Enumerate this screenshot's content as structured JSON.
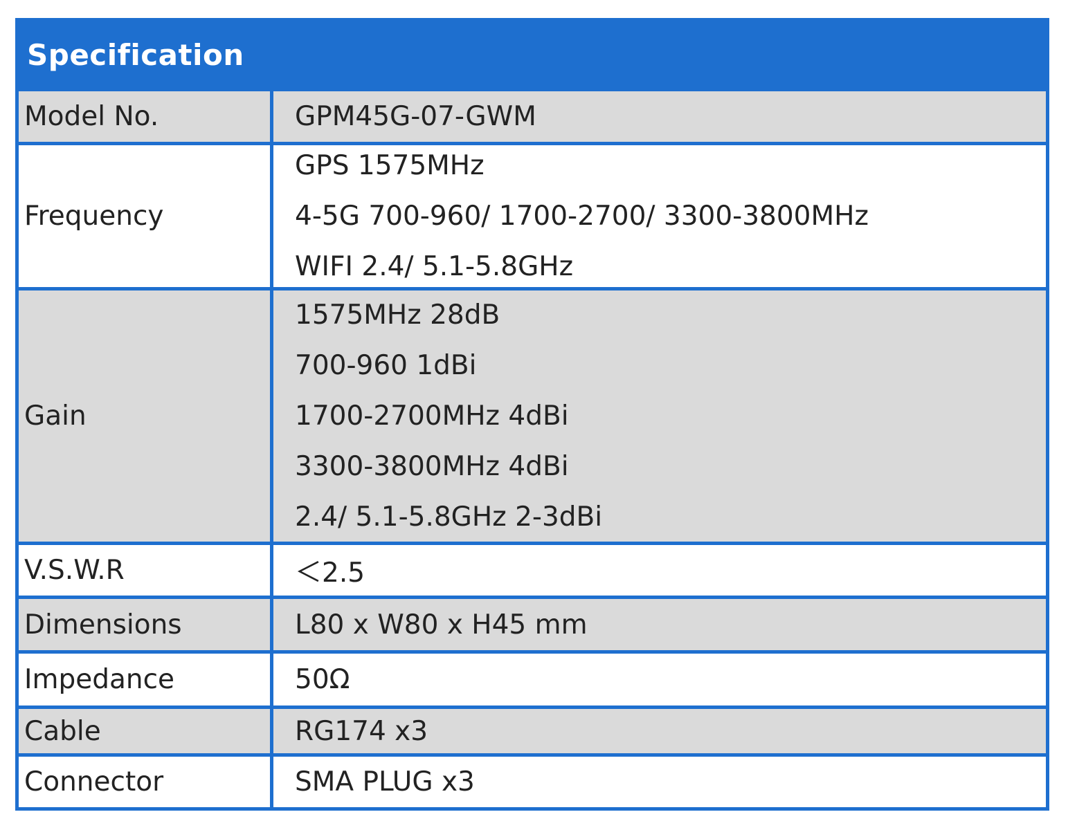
{
  "header": {
    "title": "Specification"
  },
  "rows": [
    {
      "label": "Model No.",
      "values": [
        "GPM45G-07-GWM"
      ]
    },
    {
      "label": "Frequency",
      "values": [
        "GPS 1575MHz",
        "4-5G 700-960/ 1700-2700/ 3300-3800MHz",
        "WIFI 2.4/ 5.1-5.8GHz"
      ]
    },
    {
      "label": "Gain",
      "values": [
        "1575MHz 28dB",
        "700-960 1dBi",
        "1700-2700MHz 4dBi",
        "3300-3800MHz 4dBi",
        "2.4/ 5.1-5.8GHz 2-3dBi"
      ]
    },
    {
      "label": "V.S.W.R",
      "values": [
        "＜2.5"
      ]
    },
    {
      "label": "Dimensions",
      "values": [
        "L80 x W80 x H45 mm"
      ]
    },
    {
      "label": "Impedance",
      "values": [
        "50Ω"
      ]
    },
    {
      "label": "Cable",
      "values": [
        "RG174 x3"
      ]
    },
    {
      "label": "Connector",
      "values": [
        "SMA PLUG x3"
      ]
    }
  ],
  "colors": {
    "border": "#1e6fcf",
    "header_bg": "#1e6fcf",
    "header_text": "#ffffff",
    "row_gray": "#dadada",
    "row_white": "#ffffff",
    "text": "#222222"
  }
}
